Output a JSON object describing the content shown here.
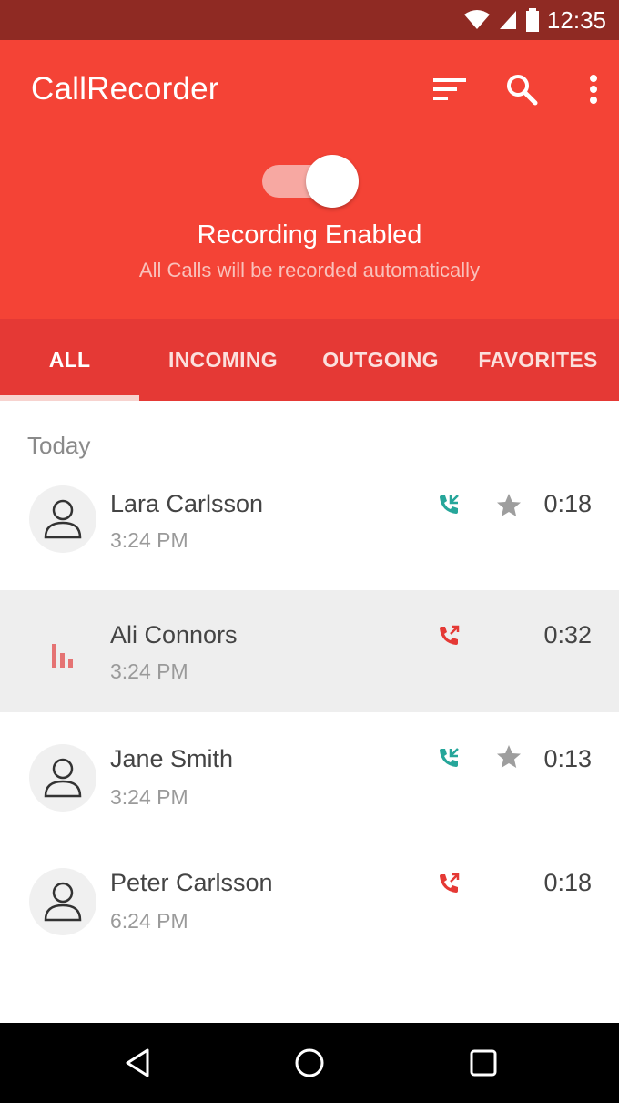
{
  "status_bar": {
    "time": "12:35"
  },
  "header": {
    "title": "CallRecorder",
    "recording_title": "Recording Enabled",
    "recording_subtitle": "All Calls will be recorded automatically",
    "recording_enabled": true
  },
  "tabs": [
    {
      "label": "ALL",
      "selected": true
    },
    {
      "label": "INCOMING",
      "selected": false
    },
    {
      "label": "OUTGOING",
      "selected": false
    },
    {
      "label": "FAVORITES",
      "selected": false
    }
  ],
  "section_label": "Today",
  "calls": [
    {
      "name": "Lara Carlsson",
      "time": "3:24 PM",
      "duration": "0:18",
      "direction": "incoming",
      "favorite": true,
      "playing": false
    },
    {
      "name": "Ali Connors",
      "time": "3:24 PM",
      "duration": "0:32",
      "direction": "outgoing",
      "favorite": false,
      "playing": true
    },
    {
      "name": "Jane Smith",
      "time": "3:24 PM",
      "duration": "0:13",
      "direction": "incoming",
      "favorite": true,
      "playing": false
    },
    {
      "name": "Peter Carlsson",
      "time": "6:24 PM",
      "duration": "0:18",
      "direction": "outgoing",
      "favorite": false,
      "playing": false
    }
  ],
  "icons": {
    "toolbar": [
      "sort-icon",
      "search-icon",
      "more-vert-icon"
    ],
    "nav": [
      "back-icon",
      "home-icon",
      "recents-icon"
    ]
  },
  "colors": {
    "primary": "#f44336",
    "tab_bar": "#e53935",
    "status_bar": "#8f2a23",
    "incoming_call": "#26a69a",
    "outgoing_call": "#e53935",
    "star": "#9e9e9e"
  }
}
